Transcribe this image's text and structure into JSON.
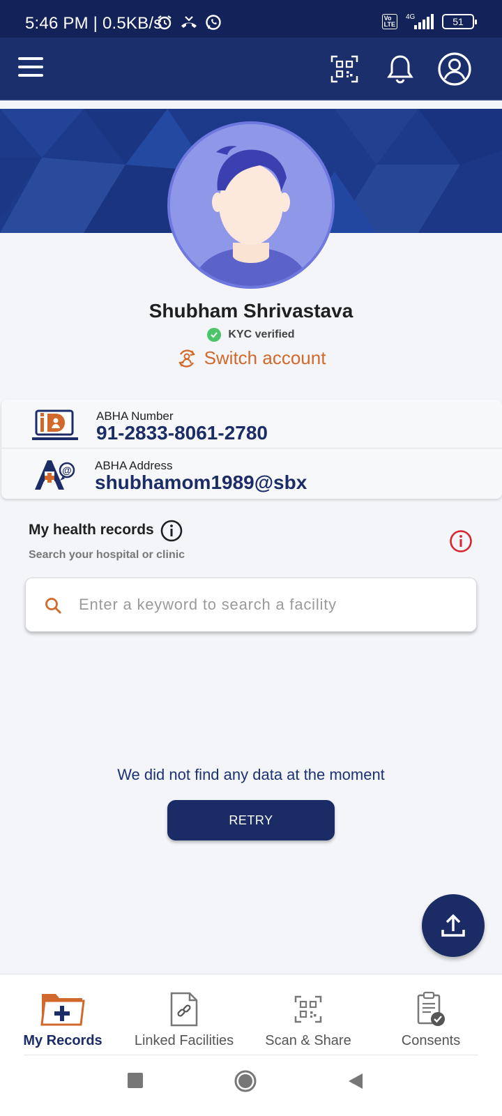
{
  "status_bar": {
    "time": "5:46 PM | 0.5KB/s",
    "network": "4G",
    "battery": "51"
  },
  "app_bar": {
    "icons": [
      "menu-icon",
      "qr-scan-icon",
      "bell-icon",
      "profile-icon"
    ]
  },
  "profile": {
    "name": "Shubham Shrivastava",
    "kyc_status": "KYC verified",
    "switch_account": "Switch account"
  },
  "abha": {
    "number_label": "ABHA Number",
    "number_value": "91-2833-8061-2780",
    "address_label": "ABHA Address",
    "address_value": "shubhamom1989@sbx"
  },
  "health_records": {
    "title": "My health records",
    "subtitle": "Search your hospital or clinic",
    "search_placeholder": "Enter a keyword to search a facility",
    "empty_message": "We did not find any data at the moment",
    "retry_label": "RETRY"
  },
  "bottom_nav": {
    "items": [
      {
        "label": "My Records",
        "active": true
      },
      {
        "label": "Linked Facilities",
        "active": false
      },
      {
        "label": "Scan & Share",
        "active": false
      },
      {
        "label": "Consents",
        "active": false
      }
    ]
  },
  "colors": {
    "primary": "#1a2b66",
    "accent": "#d2692c",
    "success": "#4cc46b",
    "alert": "#d9232d"
  }
}
